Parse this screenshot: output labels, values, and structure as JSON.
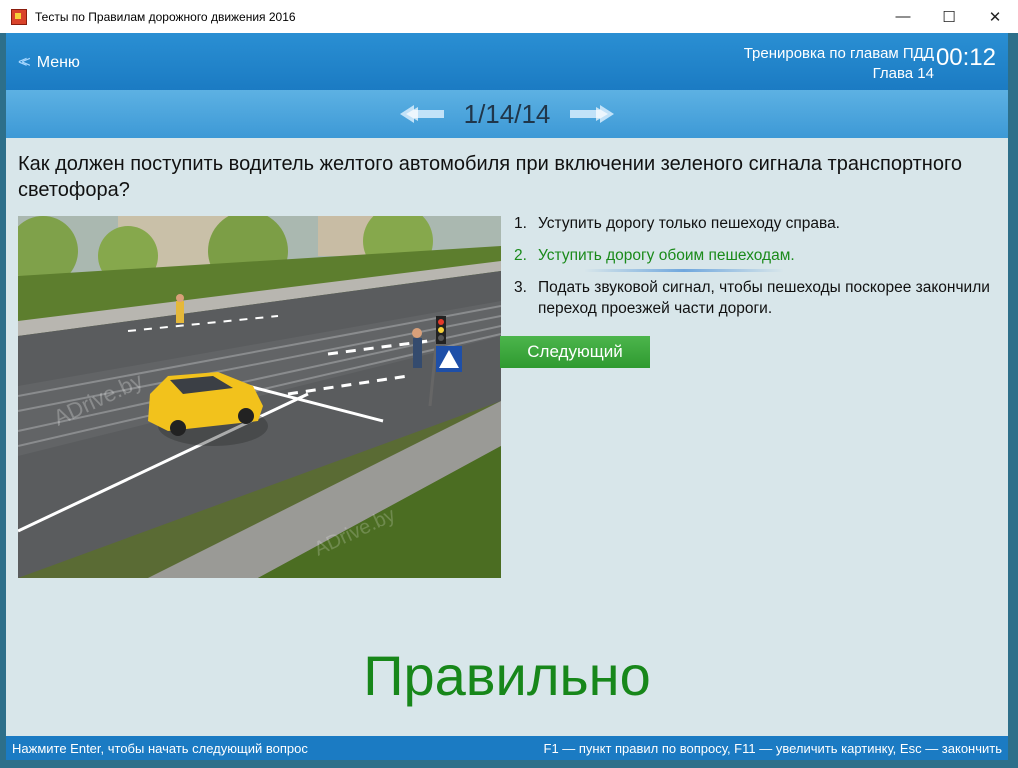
{
  "window": {
    "title": "Тесты по Правилам дорожного движения 2016",
    "buttons": {
      "minimize": "—",
      "maximize": "☐",
      "close": "✕"
    }
  },
  "header": {
    "menu_label": "Меню",
    "mode_title": "Тренировка по главам ПДД",
    "chapter": "Глава 14",
    "timer": "00:12"
  },
  "nav": {
    "counter": "1/14/14"
  },
  "question": {
    "text": "Как должен поступить водитель желтого автомобиля при включении зеленого сигнала транспортного светофора?",
    "image_watermark": "ADrive.by"
  },
  "answers": [
    {
      "num": "1.",
      "text": "Уступить дорогу только пешеходу справа."
    },
    {
      "num": "2.",
      "text": "Уступить дорогу обоим пешеходам."
    },
    {
      "num": "3.",
      "text": "Подать звуковой сигнал, чтобы пешеходы поскорее закончили переход проезжей части дороги."
    }
  ],
  "next_button": "Следующий",
  "result": "Правильно",
  "status": {
    "left": "Нажмите Enter, чтобы начать следующий вопрос",
    "right": "F1 — пункт правил по вопросу, F11 — увеличить картинку, Esc — закончить"
  },
  "colors": {
    "header": "#1b7bc3",
    "navbar": "#4aa3db",
    "correct": "#1a8a1a",
    "next_button": "#3aa83a",
    "background": "#d8e6ea"
  }
}
